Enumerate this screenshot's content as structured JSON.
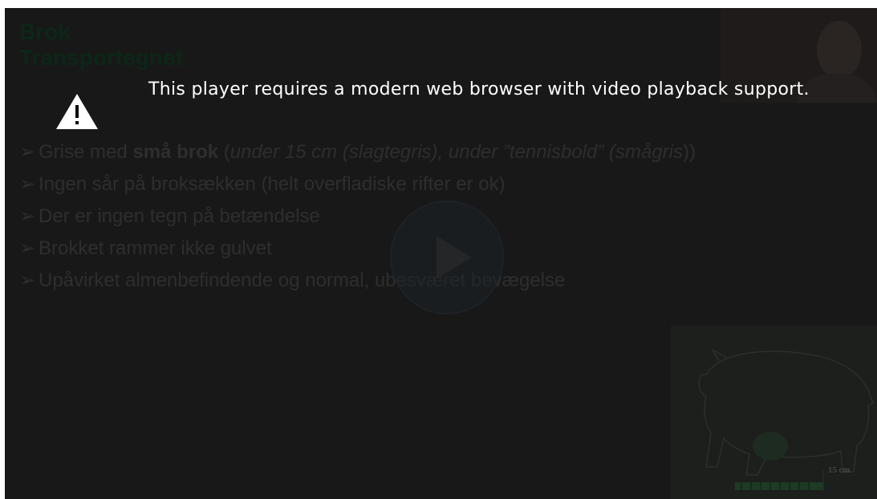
{
  "slide": {
    "title_line1": "Brok",
    "title_line2": "Transportegnet",
    "bullets": [
      {
        "arrow": "➢",
        "t1": "Grise med ",
        "b1": "små brok",
        "t2": " (",
        "i1": "under 15 cm (slagtegris), under ”tennisbold” (smågris",
        "t3": "))"
      },
      {
        "arrow": "➢",
        "text": "Ingen sår på broksækken (helt overfladiske rifter er ok)"
      },
      {
        "arrow": "➢",
        "text": "Der er ingen tegn på betændelse"
      },
      {
        "arrow": "➢",
        "text": "Brokket rammer ikke gulvet"
      },
      {
        "arrow": "➢",
        "text": "Upåvirket almenbefindende og normal, ubesværet bevægelse"
      }
    ]
  },
  "pig_image": {
    "scale_label": "15 cm"
  },
  "notice": {
    "message": "This player requires a modern web browser with video playback support.",
    "icon": "warning-icon"
  },
  "player": {
    "play_icon": "play-icon"
  },
  "colors": {
    "player_bg": "#181818",
    "notice_text": "#ffffff",
    "title": "#0c2717"
  }
}
